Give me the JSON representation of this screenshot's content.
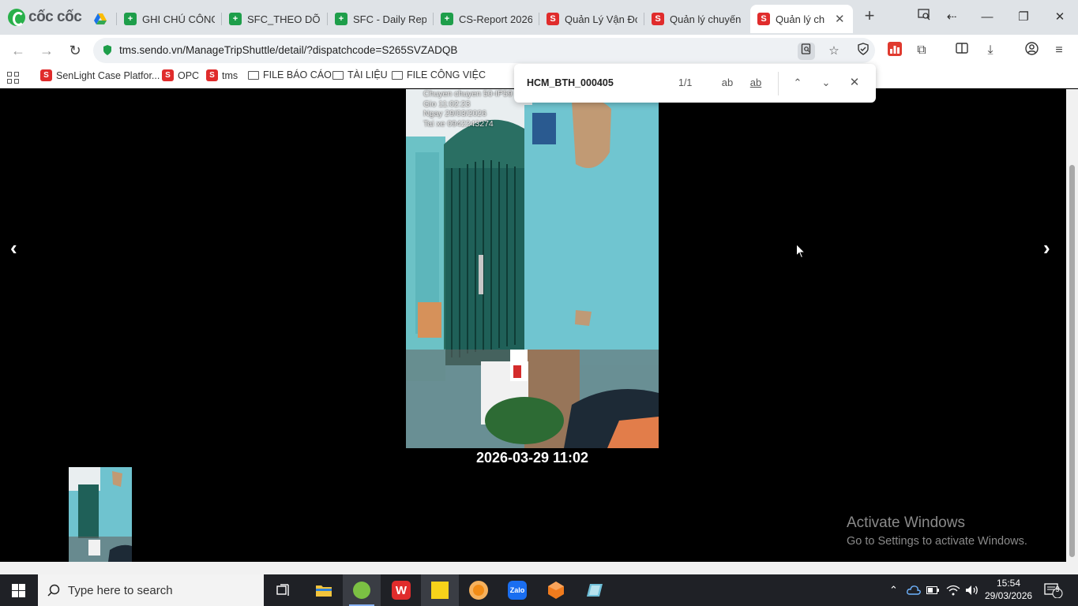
{
  "browser": {
    "logo_text": "cốc cốc",
    "tabs": [
      {
        "title": "",
        "icon": "google-drive-icon"
      },
      {
        "title": "GHI CHÚ CÔNG",
        "icon": "sheets-icon"
      },
      {
        "title": "SFC_THEO DÕI",
        "icon": "sheets-icon"
      },
      {
        "title": "SFC - Daily Repo",
        "icon": "sheets-icon"
      },
      {
        "title": "CS-Report 2026",
        "icon": "sheets-icon"
      },
      {
        "title": "Quản Lý Vận Đơ",
        "icon": "sendo-icon"
      },
      {
        "title": "Quản lý chuyến",
        "icon": "sendo-icon"
      },
      {
        "title": "Quản lý ch",
        "icon": "sendo-icon",
        "active": true
      }
    ],
    "url": "tms.sendo.vn/ManageTripShuttle/detail/?dispatchcode=S265SVZADQB",
    "bookmarks": [
      {
        "label": "SenLight Case Platfor...",
        "icon": "sendo-icon"
      },
      {
        "label": "OPC",
        "icon": "sendo-icon"
      },
      {
        "label": "tms",
        "icon": "sendo-icon"
      },
      {
        "label": "FILE BÁO CÁO",
        "icon": "folder-icon"
      },
      {
        "label": "TÀI LIỆU",
        "icon": "folder-icon"
      },
      {
        "label": "FILE CÔNG VIỆC",
        "icon": "folder-icon"
      }
    ]
  },
  "find": {
    "query": "HCM_BTH_000405",
    "count": "1/1",
    "match_case_label": "ab",
    "whole_word_label": "ab"
  },
  "viewer": {
    "stamp_lines": [
      "Chuyen chuyen 50-IP59",
      "Gio 11:02:23",
      "Ngay 29/03/2026",
      "Tai xe 0942243274"
    ],
    "caption": "2026-03-29 11:02",
    "prev_label": "‹",
    "next_label": "›"
  },
  "watermark": {
    "title": "Activate Windows",
    "subtitle": "Go to Settings to activate Windows."
  },
  "taskbar": {
    "search_placeholder": "Type here to search",
    "time": "15:54",
    "date": "29/03/2026",
    "notification_count": "9"
  }
}
